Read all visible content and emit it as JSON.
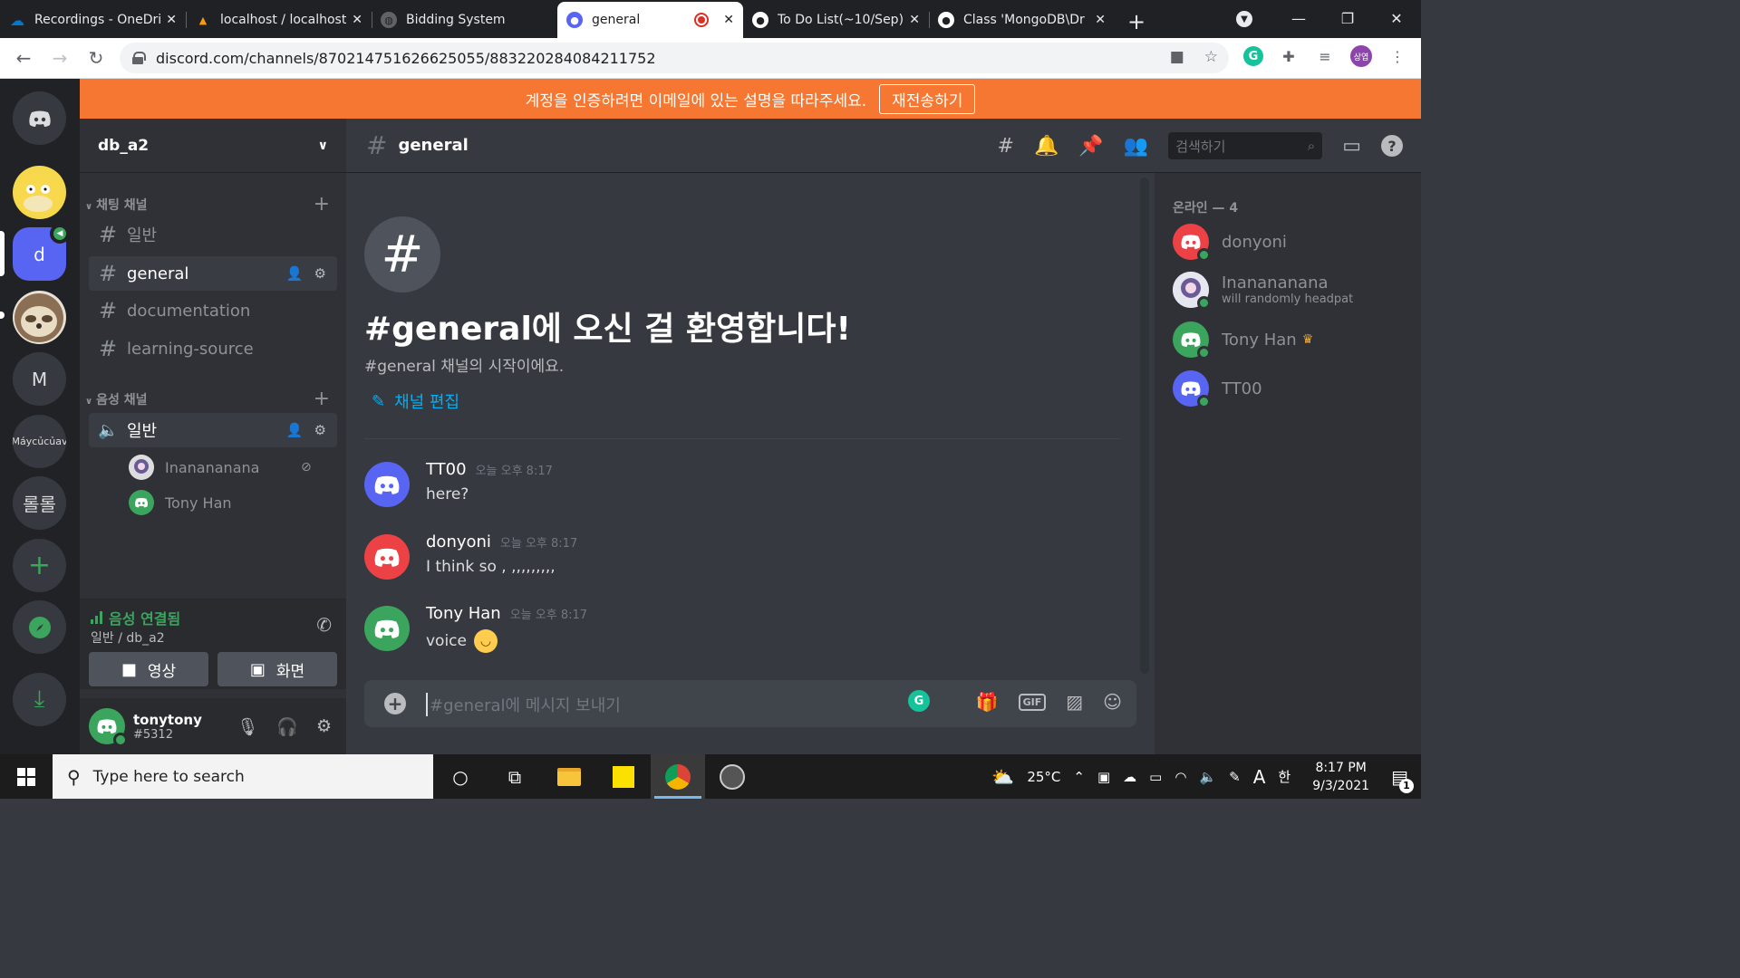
{
  "browser": {
    "tabs": [
      {
        "title": "Recordings - OneDrive",
        "icon": "cloud-icon",
        "color": "#0078d4"
      },
      {
        "title": "localhost / localhost",
        "icon": "phpmyadmin-icon",
        "color": "#f89c0e"
      },
      {
        "title": "Bidding System",
        "icon": "globe-icon",
        "color": "#5f6368"
      },
      {
        "title": "general",
        "icon": "discord-icon",
        "color": "#5865f2",
        "active": true
      },
      {
        "title": "To Do List(~10/Sep)",
        "icon": "github-icon",
        "color": "#ffffff"
      },
      {
        "title": "Class 'MongoDB\\Dr",
        "icon": "github-icon",
        "color": "#ffffff"
      }
    ],
    "url": "discord.com/channels/870214751626625055/883220284084211752",
    "profile_initials": "상엽"
  },
  "banner": {
    "text": "계정을 인증하려면 이메일에 있는 설명을 따라주세요.",
    "button": "재전송하기",
    "color": "#f57731"
  },
  "servers": [
    {
      "label": "",
      "icon": "discord-home-icon"
    },
    {
      "label": "",
      "icon": "psyduck-avatar"
    },
    {
      "label": "d",
      "icon": "server-d",
      "active": true,
      "voice": true
    },
    {
      "label": "",
      "icon": "sloth-avatar"
    },
    {
      "label": "M",
      "icon": "server-m"
    },
    {
      "label": "Máycủcủav",
      "icon": "server-may"
    },
    {
      "label": "롤롤",
      "icon": "server-rolrol"
    },
    {
      "label": "+",
      "icon": "add-server-icon"
    },
    {
      "label": "",
      "icon": "explore-icon"
    },
    {
      "label": "",
      "icon": "download-icon"
    }
  ],
  "sidebar": {
    "server_name": "db_a2",
    "text_category": "채팅 채널",
    "text_channels": [
      {
        "name": "일반"
      },
      {
        "name": "general",
        "active": true
      },
      {
        "name": "documentation"
      },
      {
        "name": "learning-source"
      }
    ],
    "voice_category": "음성 채널",
    "voice_channel": "일반",
    "voice_users": [
      {
        "name": "Inanananana"
      },
      {
        "name": "Tony Han"
      }
    ],
    "voice_status": "음성 연결됨",
    "voice_sub": "일반 / db_a2",
    "video_label": "영상",
    "screen_label": "화면",
    "user": {
      "name": "tonytony",
      "tag": "#5312"
    }
  },
  "chat": {
    "channel": "general",
    "search_placeholder": "검색하기",
    "welcome_title": "#general에 오신 걸 환영합니다!",
    "welcome_sub": "#general 채널의 시작이에요.",
    "edit_channel": "채널 편집",
    "messages": [
      {
        "author": "TT00",
        "time": "오늘 오후 8:17",
        "text": "here?",
        "color": "#5865f2"
      },
      {
        "author": "donyoni",
        "time": "오늘 오후 8:17",
        "text": "I think so , ,,,,,,,,,",
        "color": "#ed4245"
      },
      {
        "author": "Tony Han",
        "time": "오늘 오후 8:17",
        "text": "voice",
        "color": "#3ba55d",
        "emoji": "slightly-smiling-face"
      }
    ],
    "composer_placeholder": "#general에 메시지 보내기",
    "gif_label": "GIF"
  },
  "members": {
    "title": "온라인 — 4",
    "list": [
      {
        "name": "donyoni",
        "status": "",
        "color": "#ed4245"
      },
      {
        "name": "Inanananana",
        "status": "will randomly headpat",
        "color": "#6b5b95"
      },
      {
        "name": "Tony Han",
        "status": "",
        "color": "#3ba55d",
        "owner": true
      },
      {
        "name": "TT00",
        "status": "",
        "color": "#5865f2"
      }
    ]
  },
  "taskbar": {
    "search_placeholder": "Type here to search",
    "temperature": "25°C",
    "time": "8:17 PM",
    "date": "9/3/2021",
    "ime": "A",
    "ime2": "한",
    "notifications": "1"
  }
}
